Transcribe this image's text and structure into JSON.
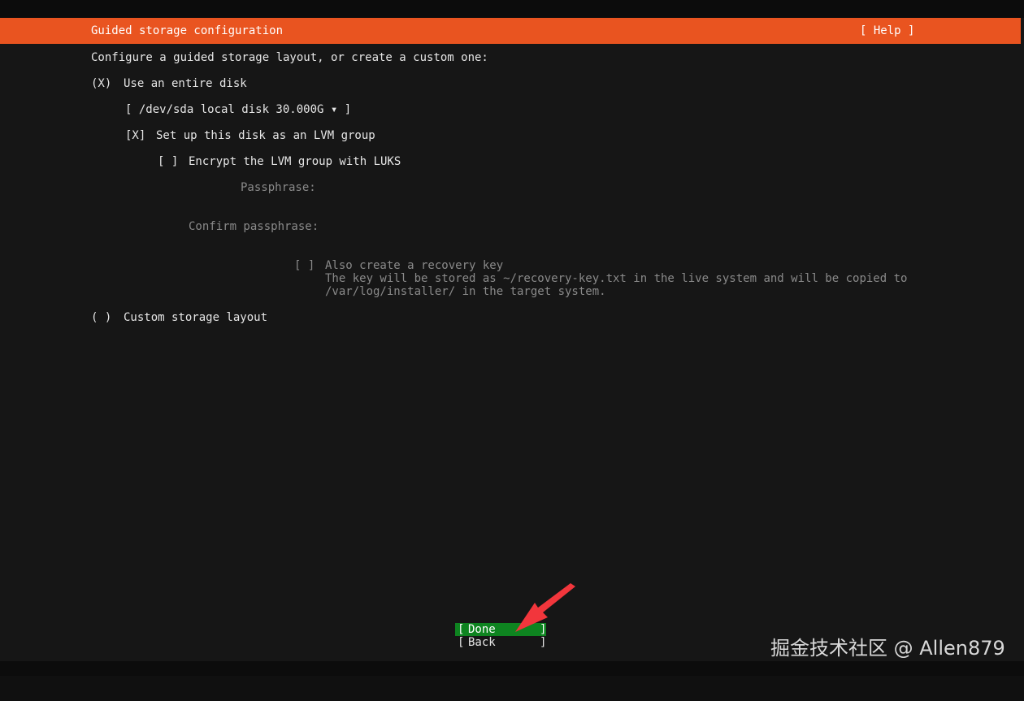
{
  "header": {
    "title": "Guided storage configuration",
    "help": "[ Help ]",
    "color": "#e95420"
  },
  "intro": "Configure a guided storage layout, or create a custom one:",
  "options": {
    "entire_disk": {
      "marker": "(X)",
      "label": "Use an entire disk"
    },
    "disk_select": {
      "value": "[ /dev/sda local disk 30.000G ▾ ]"
    },
    "lvm": {
      "marker": "[X]",
      "label": "Set up this disk as an LVM group"
    },
    "encrypt": {
      "marker": "[ ]",
      "label": "Encrypt the LVM group with LUKS"
    },
    "passphrase_label": "Passphrase:",
    "confirm_label": "Confirm passphrase:",
    "recovery": {
      "marker": "[ ]",
      "label": "Also create a recovery key",
      "desc_line1": "The key will be stored as ~/recovery-key.txt in the live system and will be copied to",
      "desc_line2": "/var/log/installer/ in the target system."
    },
    "custom": {
      "marker": "( )",
      "label": "Custom storage layout"
    }
  },
  "buttons": {
    "done": "Done",
    "back": "Back",
    "open_bracket": "[",
    "close_bracket": "]",
    "done_color": "#0e8420"
  },
  "watermark": "掘金技术社区 @ Allen879",
  "annotation": {
    "arrow_icon": "red-arrow-icon",
    "color": "#f2363c"
  }
}
